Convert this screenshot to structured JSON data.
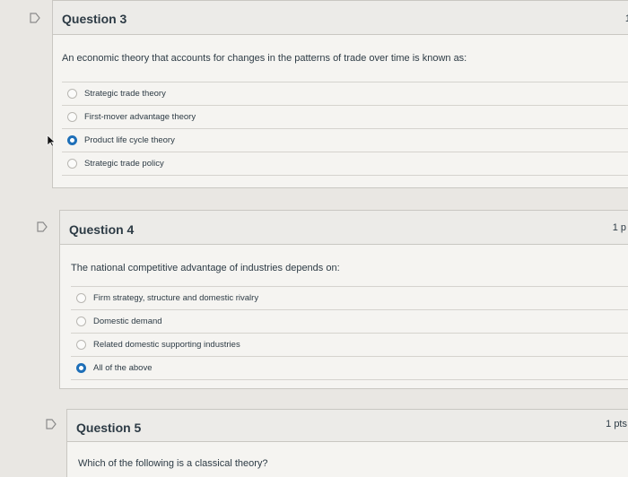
{
  "questions": [
    {
      "title": "Question 3",
      "points": "1",
      "text": "An economic theory that accounts for changes in the patterns of trade over time is known as:",
      "answers": [
        {
          "label": "Strategic trade theory",
          "selected": false
        },
        {
          "label": "First-mover advantage theory",
          "selected": false
        },
        {
          "label": "Product life cycle theory",
          "selected": true
        },
        {
          "label": "Strategic trade policy",
          "selected": false
        }
      ]
    },
    {
      "title": "Question 4",
      "points": "1 p",
      "text": "The national competitive advantage of industries depends on:",
      "answers": [
        {
          "label": "Firm strategy, structure and domestic rivalry",
          "selected": false
        },
        {
          "label": "Domestic demand",
          "selected": false
        },
        {
          "label": "Related domestic supporting industries",
          "selected": false
        },
        {
          "label": "All of the above",
          "selected": true
        }
      ]
    },
    {
      "title": "Question 5",
      "points": "1 pts",
      "text": "Which of the following is a classical theory?",
      "answers": []
    }
  ],
  "icons": {
    "flag": "flag-icon",
    "cursor": "mouse-pointer-icon"
  },
  "colors": {
    "radio_selected": "#1e6fb8",
    "panel": "#f5f4f1",
    "header": "#ecebe8"
  }
}
